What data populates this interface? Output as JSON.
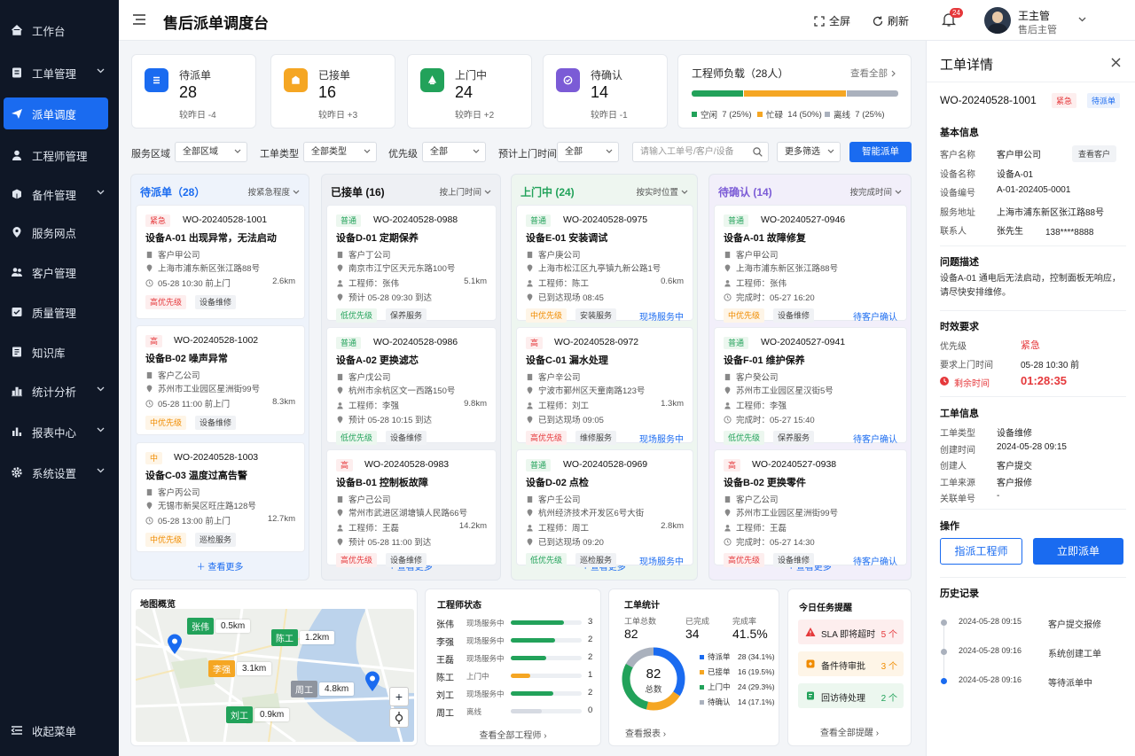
{
  "app": {
    "title": "售后派单调度台"
  },
  "sidebar": {
    "items": [
      {
        "label": "工作台",
        "icon": "home-icon",
        "active": false,
        "chev": false
      },
      {
        "label": "工单管理",
        "icon": "ticket-icon",
        "active": false,
        "chev": true
      },
      {
        "label": "派单调度",
        "icon": "send-icon",
        "active": true,
        "chev": false
      },
      {
        "label": "工程师管理",
        "icon": "user-icon",
        "active": false,
        "chev": false
      },
      {
        "label": "备件管理",
        "icon": "box-icon",
        "active": false,
        "chev": true
      },
      {
        "label": "服务网点",
        "icon": "location-icon",
        "active": false,
        "chev": false
      },
      {
        "label": "客户管理",
        "icon": "users-icon",
        "active": false,
        "chev": false
      },
      {
        "label": "质量管理",
        "icon": "quality-icon",
        "active": false,
        "chev": false
      },
      {
        "label": "知识库",
        "icon": "book-icon",
        "active": false,
        "chev": false
      },
      {
        "label": "统计分析",
        "icon": "bar-chart-icon",
        "active": false,
        "chev": true
      },
      {
        "label": "报表中心",
        "icon": "report-icon",
        "active": false,
        "chev": true
      },
      {
        "label": "系统设置",
        "icon": "gear-icon",
        "active": false,
        "chev": true
      }
    ],
    "collapse": "收起菜单"
  },
  "header": {
    "fullscreen": "全屏",
    "refresh": "刷新",
    "notifications": "24",
    "user_name": "王主管",
    "user_role": "售后主管"
  },
  "stats": [
    {
      "label": "待派单",
      "value": "28",
      "cmp": "较昨日 -4",
      "color": "#1a6bf0"
    },
    {
      "label": "已接单",
      "value": "16",
      "cmp": "较昨日 +3",
      "color": "#f5a623"
    },
    {
      "label": "上门中",
      "value": "24",
      "cmp": "较昨日 +2",
      "color": "#22a25a"
    },
    {
      "label": "待确认",
      "value": "14",
      "cmp": "较昨日 -1",
      "color": "#7b5bd6"
    }
  ],
  "load": {
    "title": "工程师负载（28人）",
    "view_all": "查看全部",
    "segments": [
      {
        "label": "空闲",
        "value": "7 (25%)",
        "share": 25,
        "color": "#22a25a"
      },
      {
        "label": "忙碌",
        "value": "14 (50%)",
        "share": 50,
        "color": "#f5a623"
      },
      {
        "label": "离线",
        "value": "7 (25%)",
        "share": 25,
        "color": "#aab1bd"
      }
    ]
  },
  "filters": {
    "area_label": "服务区域",
    "area": "全部区域",
    "type_label": "工单类型",
    "type": "全部类型",
    "pri_label": "优先级",
    "pri": "全部",
    "time_label": "预计上门时间",
    "time": "全部",
    "search_ph": "请输入工单号/客户/设备",
    "more": "更多筛选",
    "smart": "智能派单"
  },
  "columns": [
    {
      "title": "待派单（28）",
      "sort": "按紧急程度",
      "color": "#1a6bf0",
      "bg": "#eef3fb",
      "more": "查看更多",
      "orders": [
        {
          "pr": "紧急",
          "no": "WO-20240528-1001",
          "title": "设备A-01  出现异常，无法启动",
          "customer": "客户甲公司",
          "addr": "上海市浦东新区张江路88号",
          "time": "05-28 10:30 前上门",
          "dist": "2.6km",
          "tags": [
            "高优先级",
            "设备维修"
          ],
          "status": ""
        },
        {
          "pr": "高",
          "no": "WO-20240528-1002",
          "title": "设备B-02  噪声异常",
          "customer": "客户乙公司",
          "addr": "苏州市工业园区星洲街99号",
          "time": "05-28 11:00 前上门",
          "dist": "8.3km",
          "tags": [
            "中优先级",
            "设备维修"
          ],
          "status": ""
        },
        {
          "pr": "中",
          "no": "WO-20240528-1003",
          "title": "设备C-03  温度过高告警",
          "customer": "客户丙公司",
          "addr": "无锡市新吴区旺庄路128号",
          "time": "05-28 13:00 前上门",
          "dist": "12.7km",
          "tags": [
            "中优先级",
            "巡检服务"
          ],
          "status": ""
        }
      ]
    },
    {
      "title": "已接单  (16)",
      "sort": "按上门时间",
      "color": "#111111",
      "bg": "#eef0f4",
      "more": "查看更多",
      "orders": [
        {
          "pr": "普通",
          "no": "WO-20240528-0988",
          "title": "设备D-01  定期保养",
          "customer": "客户丁公司",
          "addr": "南京市江宁区天元东路100号",
          "eng": "工程师：张伟",
          "eta": "预计 05-28 09:30 到达",
          "dist": "5.1km",
          "tags": [
            "低优先级",
            "保养服务"
          ],
          "status": ""
        },
        {
          "pr": "普通",
          "no": "WO-20240528-0986",
          "title": "设备A-02  更换滤芯",
          "customer": "客户戊公司",
          "addr": "杭州市余杭区文一西路150号",
          "eng": "工程师：李强",
          "eta": "预计 05-28 10:15 到达",
          "dist": "9.8km",
          "tags": [
            "低优先级",
            "设备维修"
          ],
          "status": ""
        },
        {
          "pr": "高",
          "no": "WO-20240528-0983",
          "title": "设备B-01  控制板故障",
          "customer": "客户己公司",
          "addr": "常州市武进区湖塘镇人民路66号",
          "eng": "工程师：王磊",
          "eta": "预计 05-28 11:00 到达",
          "dist": "14.2km",
          "tags": [
            "高优先级",
            "设备维修"
          ],
          "status": ""
        }
      ]
    },
    {
      "title": "上门中  (24)",
      "sort": "按实时位置",
      "color": "#22a25a",
      "bg": "#eef6f0",
      "more": "查看更多",
      "orders": [
        {
          "pr": "普通",
          "no": "WO-20240528-0975",
          "title": "设备E-01  安装调试",
          "customer": "客户庚公司",
          "addr": "上海市松江区九亭镇九新公路1号",
          "eng": "工程师：陈工",
          "eta": "已到达现场 08:45",
          "dist": "0.6km",
          "tags": [
            "中优先级",
            "安装服务"
          ],
          "status": "现场服务中"
        },
        {
          "pr": "高",
          "no": "WO-20240528-0972",
          "title": "设备C-01  漏水处理",
          "customer": "客户辛公司",
          "addr": "宁波市鄞州区天童南路123号",
          "eng": "工程师：刘工",
          "eta": "已到达现场 09:05",
          "dist": "1.3km",
          "tags": [
            "高优先级",
            "维修服务"
          ],
          "status": "现场服务中"
        },
        {
          "pr": "普通",
          "no": "WO-20240528-0969",
          "title": "设备D-02  点检",
          "customer": "客户壬公司",
          "addr": "杭州经济技术开发区6号大街",
          "eng": "工程师：周工",
          "eta": "已到达现场 09:20",
          "dist": "2.8km",
          "tags": [
            "低优先级",
            "巡检服务"
          ],
          "status": "现场服务中"
        }
      ]
    },
    {
      "title": "待确认  (14)",
      "sort": "按完成时间",
      "color": "#7b5bd6",
      "bg": "#f2effa",
      "more": "查看更多",
      "orders": [
        {
          "pr": "普通",
          "no": "WO-20240527-0946",
          "title": "设备A-01  故障修复",
          "customer": "客户甲公司",
          "addr": "上海市浦东新区张江路88号",
          "eng": "工程师：张伟",
          "eta": "完成时：05-27 16:20",
          "dist": "",
          "tags": [
            "中优先级",
            "设备维修"
          ],
          "status": "待客户确认"
        },
        {
          "pr": "普通",
          "no": "WO-20240527-0941",
          "title": "设备F-01  维护保养",
          "customer": "客户癸公司",
          "addr": "苏州市工业园区星汉街5号",
          "eng": "工程师：李强",
          "eta": "完成时：05-27 15:40",
          "dist": "",
          "tags": [
            "低优先级",
            "保养服务"
          ],
          "status": "待客户确认"
        },
        {
          "pr": "高",
          "no": "WO-20240527-0938",
          "title": "设备B-02  更换零件",
          "customer": "客户乙公司",
          "addr": "苏州市工业园区星洲街99号",
          "eng": "工程师：王磊",
          "eta": "完成时：05-27 14:30",
          "dist": "",
          "tags": [
            "高优先级",
            "设备维修"
          ],
          "status": "待客户确认"
        }
      ]
    }
  ],
  "map": {
    "title": "地图概览",
    "pins": [
      {
        "name": "张伟",
        "dist": "0.5km",
        "color": "#22a25a"
      },
      {
        "name": "陈工",
        "dist": "1.2km",
        "color": "#22a25a"
      },
      {
        "name": "李强",
        "dist": "3.1km",
        "color": "#f5a623"
      },
      {
        "name": "周工",
        "dist": "4.8km",
        "color": "#8e949e"
      },
      {
        "name": "刘工",
        "dist": "0.9km",
        "color": "#22a25a"
      }
    ],
    "zoom_in": "+"
  },
  "eng_status": {
    "title": "工程师状态",
    "rows": [
      {
        "name": "张伟",
        "status": "现场服务中",
        "count": "3",
        "fill": 0.75,
        "color": "#22a25a"
      },
      {
        "name": "李强",
        "status": "现场服务中",
        "count": "2",
        "fill": 0.63,
        "color": "#22a25a"
      },
      {
        "name": "王磊",
        "status": "现场服务中",
        "count": "2",
        "fill": 0.5,
        "color": "#22a25a"
      },
      {
        "name": "陈工",
        "status": "上门中",
        "count": "1",
        "fill": 0.28,
        "color": "#f5a623"
      },
      {
        "name": "刘工",
        "status": "现场服务中",
        "count": "2",
        "fill": 0.6,
        "color": "#22a25a"
      },
      {
        "name": "周工",
        "status": "离线",
        "count": "0",
        "fill": 0.44,
        "color": "#d6dae2"
      }
    ],
    "view_all": "查看全部工程师"
  },
  "order_stats": {
    "title": "工单统计",
    "total_label": "工单总数",
    "total": "82",
    "done_label": "已完成",
    "done": "34",
    "rate_label": "完成率",
    "rate": "41.5%",
    "donut_total": "82",
    "donut_label": "总数",
    "legend": [
      {
        "label": "待派单",
        "value": "28 (34.1%)",
        "share": 34.1,
        "color": "#1a6bf0"
      },
      {
        "label": "已接单",
        "value": "16 (19.5%)",
        "share": 19.5,
        "color": "#f5a623"
      },
      {
        "label": "上门中",
        "value": "24 (29.3%)",
        "share": 29.3,
        "color": "#22a25a"
      },
      {
        "label": "待确认",
        "value": "14 (17.1%)",
        "share": 17.1,
        "color": "#aab1bd"
      }
    ],
    "view": "查看报表"
  },
  "reminders": {
    "title": "今日任务提醒",
    "items": [
      {
        "label": "SLA 即将超时",
        "count": "5 个",
        "color": "#e5383b",
        "bg": "#fdeeee"
      },
      {
        "label": "备件待审批",
        "count": "3 个",
        "color": "#f08c00",
        "bg": "#fef5e7"
      },
      {
        "label": "回访待处理",
        "count": "2 个",
        "color": "#22a25a",
        "bg": "#ecf7ef"
      }
    ],
    "view": "查看全部提醒"
  },
  "detail": {
    "title": "工单详情",
    "no": "WO-20240528-1001",
    "badge1": "紧急",
    "badge2": "待派单",
    "basic_title": "基本信息",
    "basic": [
      {
        "k": "客户名称",
        "v": "客户甲公司"
      },
      {
        "k": "设备名称",
        "v": "设备A-01"
      },
      {
        "k": "设备编号",
        "v": "A-01-202405-0001"
      },
      {
        "k": "服务地址",
        "v": "上海市浦东新区张江路88号"
      },
      {
        "k": "联系人",
        "v": "张先生"
      }
    ],
    "phone": "138****8888",
    "view_customer": "查看客户",
    "problem_title": "问题描述",
    "problem": "设备A-01 通电后无法启动，控制面板无响应，请尽快安排维修。",
    "sla_title": "时效要求",
    "pri_k": "优先级",
    "pri_v": "紧急",
    "req_k": "要求上门时间",
    "req_v": "05-28  10:30 前",
    "remain_k": "剩余时间",
    "remain_v": "01:28:35",
    "info_title": "工单信息",
    "info": [
      {
        "k": "工单类型",
        "v": "设备维修"
      },
      {
        "k": "创建时间",
        "v": "2024-05-28  09:15"
      },
      {
        "k": "创建人",
        "v": "客户提交"
      },
      {
        "k": "工单来源",
        "v": "客户报修"
      },
      {
        "k": "关联单号",
        "v": "-"
      }
    ],
    "ops_title": "操作",
    "assign": "指派工程师",
    "dispatch": "立即派单",
    "history_title": "历史记录",
    "history": [
      {
        "t": "2024-05-28 09:15",
        "e": "客户提交报修"
      },
      {
        "t": "2024-05-28 09:16",
        "e": "系统创建工单"
      },
      {
        "t": "2024-05-28 09:16",
        "e": "等待派单中"
      }
    ]
  }
}
